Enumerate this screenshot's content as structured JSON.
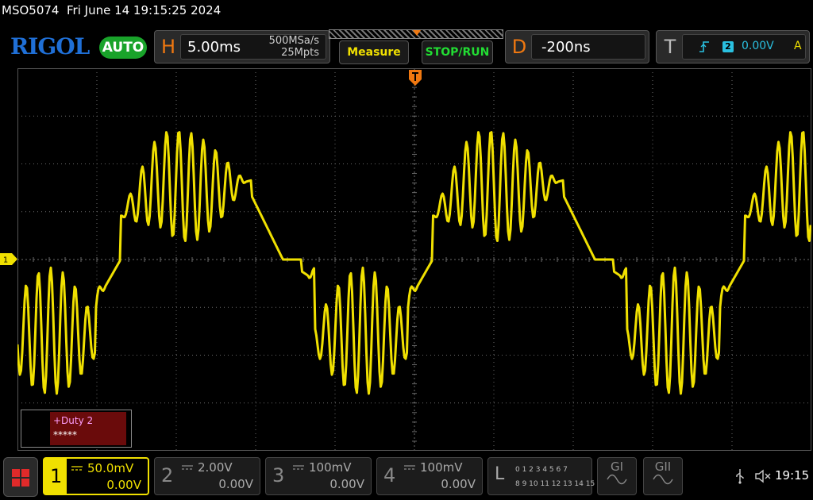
{
  "status": {
    "model": "MSO5074",
    "datetime": "Fri June 14 19:15:25 2024"
  },
  "header": {
    "brand": "RIGOL",
    "run_mode": "AUTO",
    "horizontal": {
      "letter": "H",
      "timebase": "5.00ms",
      "sample_rate": "500MSa/s",
      "memory_depth": "25Mpts"
    },
    "measure_label": "Measure",
    "stoprun_label": "STOP/RUN",
    "delay": {
      "letter": "D",
      "value": "-200ns"
    },
    "trigger": {
      "letter": "T",
      "source": "2",
      "level": "0.00V",
      "mode": "A"
    }
  },
  "screen": {
    "ch1_marker": "1",
    "measurement": {
      "label": "+Duty 2",
      "value": "*****"
    },
    "trace_color": "#f0e000",
    "grid": "on"
  },
  "channels": [
    {
      "num": "1",
      "scale": "50.0mV",
      "offset": "0.00V",
      "active": true
    },
    {
      "num": "2",
      "scale": "2.00V",
      "offset": "0.00V",
      "active": false
    },
    {
      "num": "3",
      "scale": "100mV",
      "offset": "0.00V",
      "active": false
    },
    {
      "num": "4",
      "scale": "100mV",
      "offset": "0.00V",
      "active": false
    }
  ],
  "logic": {
    "letter": "L",
    "row1": "0 1 2 3  4 5 6 7",
    "row2": "8 9 10 11 12 13 14 15"
  },
  "generators": [
    {
      "label": "GI"
    },
    {
      "label": "GII"
    }
  ],
  "clock": "19:15",
  "colors": {
    "accent_orange": "#f07810",
    "ch1_yellow": "#f0e000",
    "run_green": "#22dd33",
    "brand_blue": "#1f6fd6",
    "trigger_cyan": "#2ac0e0"
  }
}
